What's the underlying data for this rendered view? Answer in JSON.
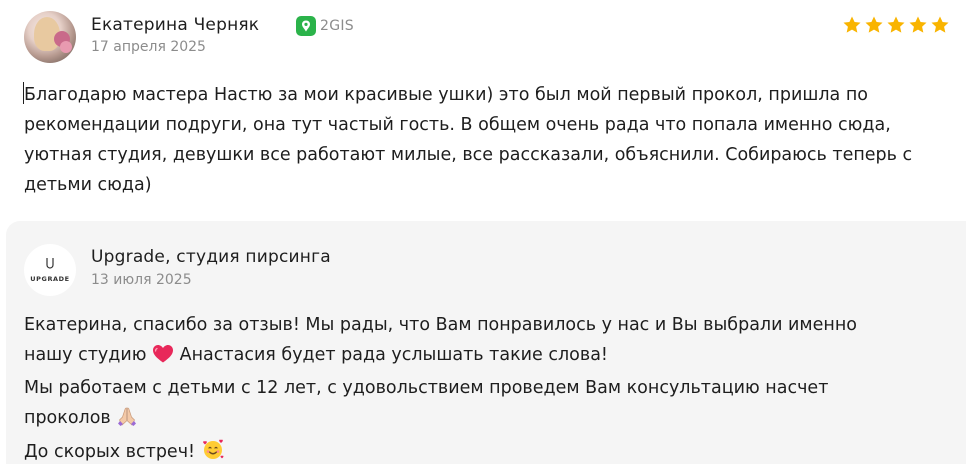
{
  "review": {
    "author": "Екатерина Черняк",
    "source": "2GIS",
    "date": "17 апреля 2025",
    "rating": 5,
    "text": "Благодарю мастера Настю за мои красивые ушки) это был мой первый прокол, пришла по рекомендации подруги, она тут частый гость. В общем очень рада что попала именно сюда, уютная студия, девушки все работают милые, все рассказали, объяснили. Собираюсь теперь с детьми сюда)"
  },
  "reply": {
    "org_name": "Upgrade, студия пирсинга",
    "org_logo_text": "UPGRADE",
    "date": "13 июля 2025",
    "line1": "Екатерина, спасибо за отзыв! Мы рады, что Вам понравилось у нас и Вы выбрали именно",
    "line2": "нашу студию",
    "line2b": "Анастасия будет рада услышать такие слова!",
    "line3": "Мы работаем с детьми с 12 лет, с удовольствием проведем Вам консультацию насчет",
    "line4": "проколов",
    "line5": "До скорых встреч!"
  },
  "colors": {
    "star": "#f9b400",
    "brand_2gis": "#2bb34a",
    "muted_text": "#8c8c8c",
    "reply_bg": "#f5f5f5"
  },
  "icons": {
    "source": "2gis-logo-icon",
    "heart": "red-heart-emoji",
    "pray": "folded-hands-emoji",
    "smile": "smiling-face-with-hearts-emoji"
  }
}
